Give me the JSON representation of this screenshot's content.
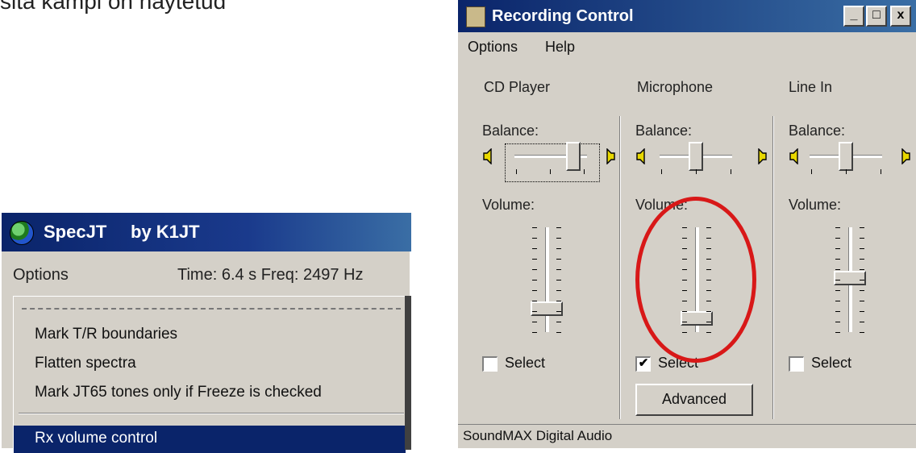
{
  "caption": "sita kampi on näytetud",
  "specjt": {
    "title_app": "SpecJT",
    "title_by": "by K1JT",
    "menu_options": "Options",
    "status": "Time:  6.4 s  Freq: 2497 Hz",
    "menu_items": [
      "Mark T/R boundaries",
      "Flatten spectra",
      "Mark JT65 tones only if Freeze is checked"
    ],
    "highlighted_item": "Rx volume control"
  },
  "recording": {
    "title": "Recording Control",
    "window_buttons": [
      "_",
      "□",
      "x"
    ],
    "menu": [
      "Options",
      "Help"
    ],
    "columns": [
      {
        "name": "CD Player",
        "balance_label": "Balance:",
        "volume_label": "Volume:",
        "select_label": "Select",
        "selected": false,
        "balance": 0.85,
        "volume": 0.18
      },
      {
        "name": "Microphone",
        "balance_label": "Balance:",
        "volume_label": "Volume:",
        "select_label": "Select",
        "selected": true,
        "balance": 0.5,
        "volume": 0.1
      },
      {
        "name": "Line In",
        "balance_label": "Balance:",
        "volume_label": "Volume:",
        "select_label": "Select",
        "selected": false,
        "balance": 0.5,
        "volume": 0.5
      }
    ],
    "advanced_button": "Advanced",
    "status": "SoundMAX Digital Audio",
    "check_mark": "✔"
  },
  "colors": {
    "titlebar": "#0a246a",
    "highlight": "#0a246a",
    "annotation": "#d81818"
  }
}
